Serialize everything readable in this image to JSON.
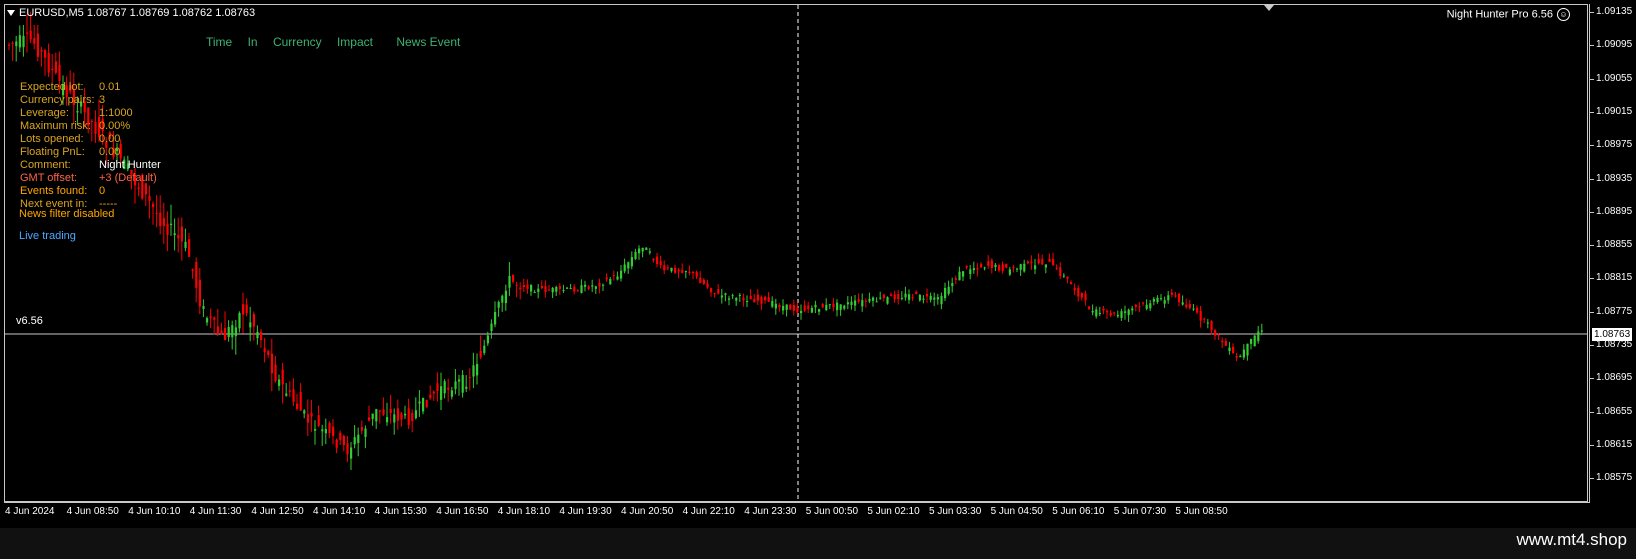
{
  "chart": {
    "symbol_title": "EURUSD,M5  1.08767 1.08769 1.08762 1.08763",
    "ea_name": "Night Hunter Pro 6.56",
    "current_price": "1.08763",
    "version": "v6.56",
    "colors": {
      "bull": "#32cd32",
      "bear": "#ff0000",
      "grid": "#c8c8c8",
      "background": "#000000"
    }
  },
  "news_header": {
    "columns": [
      "Time",
      "In",
      "Currency",
      "Impact",
      "News Event"
    ]
  },
  "info_panel": [
    {
      "label": "Expected lot:",
      "value": "0.01",
      "color": "#daa520"
    },
    {
      "label": "Currency pairs:",
      "value": "3",
      "color": "#daa520"
    },
    {
      "label": "Leverage:",
      "value": "1:1000",
      "color": "#daa520"
    },
    {
      "label": "Maximum risk:",
      "value": "0.00%",
      "color": "#daa520"
    },
    {
      "label": "Lots opened:",
      "value": "0.00",
      "color": "#daa520"
    },
    {
      "label": "Floating PnL:",
      "value": "0.00",
      "color": "#daa520"
    },
    {
      "label": "Comment:",
      "value": "Night Hunter",
      "color": "#daa520"
    },
    {
      "label": "GMT offset:",
      "value": "+3 (Default)",
      "color": "#ff6347"
    },
    {
      "label": "Events found:",
      "value": "0",
      "color": "#ffa500"
    },
    {
      "label": "Next event in:",
      "value": "-----",
      "color": "#daa520"
    }
  ],
  "status": {
    "news_filter": "News filter disabled",
    "trading_mode": "Live trading"
  },
  "price_axis": [
    "1.09135",
    "1.09095",
    "1.09055",
    "1.09015",
    "1.08975",
    "1.08935",
    "1.08895",
    "1.08855",
    "1.08815",
    "1.08775",
    "1.08735",
    "1.08695",
    "1.08655",
    "1.08615",
    "1.08575"
  ],
  "time_axis": [
    "4 Jun 2024",
    "4 Jun 08:50",
    "4 Jun 10:10",
    "4 Jun 11:30",
    "4 Jun 12:50",
    "4 Jun 14:10",
    "4 Jun 15:30",
    "4 Jun 16:50",
    "4 Jun 18:10",
    "4 Jun 19:30",
    "4 Jun 20:50",
    "4 Jun 22:10",
    "4 Jun 23:30",
    "5 Jun 00:50",
    "5 Jun 02:10",
    "5 Jun 03:30",
    "5 Jun 04:50",
    "5 Jun 06:10",
    "5 Jun 07:30",
    "5 Jun 08:50"
  ],
  "footer": {
    "watermark": "www.mt4.shop"
  }
}
